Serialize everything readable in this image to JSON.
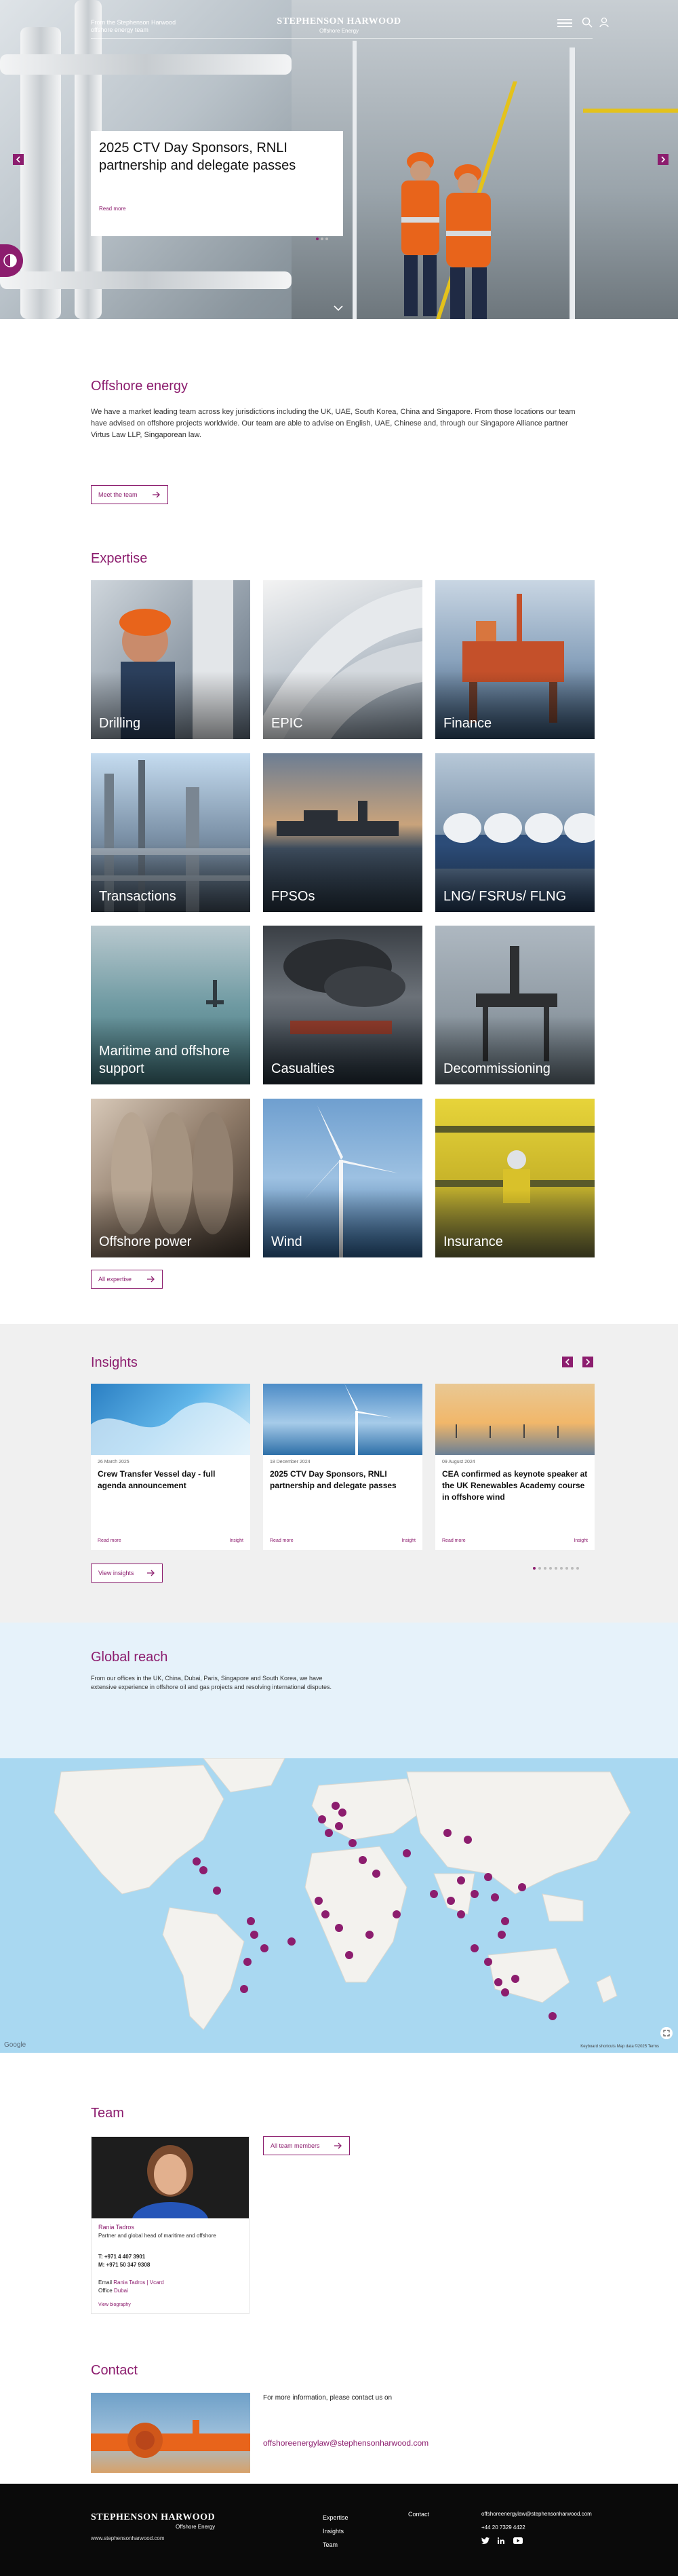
{
  "header": {
    "tagline": "From the Stephenson Harwood offshore energy team",
    "brand_name": "STEPHENSON HARWOOD",
    "brand_sub": "Offshore Energy"
  },
  "hero": {
    "headline": "2025 CTV Day Sponsors, RNLI partnership and delegate passes",
    "read_more": "Read more",
    "slide_count": 3,
    "active_slide": 1
  },
  "intro": {
    "title": "Offshore energy",
    "body": "We have a market leading team across key jurisdictions including the UK, UAE, South Korea, China and Singapore. From those locations our team have advised on offshore projects worldwide. Our team are able to advise on English, UAE, Chinese and, through our Singapore Alliance partner Virtus Law LLP, Singaporean law.",
    "button": "Meet the team"
  },
  "expertise": {
    "title": "Expertise",
    "tiles": [
      {
        "label": "Drilling"
      },
      {
        "label": "EPIC"
      },
      {
        "label": "Finance"
      },
      {
        "label": "Transactions"
      },
      {
        "label": "FPSOs"
      },
      {
        "label": "LNG/ FSRUs/ FLNG"
      },
      {
        "label": "Maritime and offshore support"
      },
      {
        "label": "Casualties"
      },
      {
        "label": "Decommissioning"
      },
      {
        "label": "Offshore power"
      },
      {
        "label": "Wind"
      },
      {
        "label": "Insurance"
      }
    ],
    "button": "All expertise"
  },
  "insights": {
    "title": "Insights",
    "cards": [
      {
        "date": "26 March 2025",
        "title": "Crew Transfer Vessel day - full agenda announcement",
        "read_more": "Read more",
        "type": "Insight"
      },
      {
        "date": "18 December 2024",
        "title": "2025 CTV Day Sponsors, RNLI partnership and delegate passes",
        "read_more": "Read more",
        "type": "Insight"
      },
      {
        "date": "09 August 2024",
        "title": "CEA confirmed as keynote speaker at the UK Renewables Academy course in offshore wind",
        "read_more": "Read more",
        "type": "Insight"
      }
    ],
    "page_count": 9,
    "active_page": 1,
    "button": "View insights"
  },
  "global": {
    "title": "Global reach",
    "body": "From our offices in the UK, China, Dubai, Paris, Singapore and South Korea, we have extensive experience in offshore oil and gas projects and resolving international disputes.",
    "map_attribution": "Google",
    "map_credits": "Keyboard shortcuts   Map data ©2025   Terms"
  },
  "team": {
    "title": "Team",
    "button": "All team members",
    "person": {
      "name": "Rania Tadros",
      "role": "Partner and global head of maritime and offshore",
      "tel": "T:  +971 4 407 3901",
      "mob": "M:  +971 50 347 9308",
      "email_label": "Email",
      "email_links": "Rania Tadros | Vcard",
      "office_label": "Office",
      "office": "Dubai",
      "bio": "View biography"
    }
  },
  "contact": {
    "title": "Contact",
    "text": "For more information, please contact us on",
    "email": "offshoreenergylaw@stephensonharwood.com"
  },
  "footer": {
    "brand_name": "STEPHENSON HARWOOD",
    "brand_sub": "Offshore Energy",
    "site": "www.stephensonharwood.com",
    "nav": [
      "Expertise",
      "Insights",
      "Team"
    ],
    "contact": "Contact",
    "email": "offshoreenergylaw@stephensonharwood.com",
    "phone": "+44 20 7329 4422"
  },
  "colors": {
    "accent": "#8c1d6e",
    "insights_bg": "#f0f0f0",
    "global_bg": "#e6f2fa",
    "map_water": "#a9d8f1",
    "footer_bg": "#0a0a0a"
  }
}
